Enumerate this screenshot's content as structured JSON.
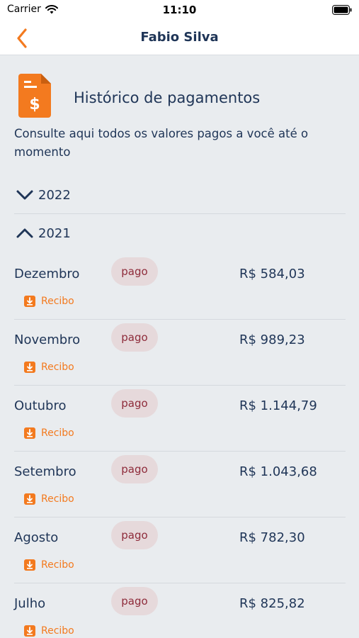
{
  "status_bar": {
    "carrier": "Carrier",
    "time": "11:10"
  },
  "nav": {
    "title": "Fabio Silva"
  },
  "header": {
    "title": "Histórico de pagamentos",
    "description": "Consulte aqui todos os valores pagos a você até o momento"
  },
  "years": [
    {
      "label": "2022",
      "expanded": false
    },
    {
      "label": "2021",
      "expanded": true
    }
  ],
  "payments": [
    {
      "month": "Dezembro",
      "status": "pago",
      "amount": "R$ 584,03",
      "receipt": "Recibo"
    },
    {
      "month": "Novembro",
      "status": "pago",
      "amount": "R$ 989,23",
      "receipt": "Recibo"
    },
    {
      "month": "Outubro",
      "status": "pago",
      "amount": "R$ 1.144,79",
      "receipt": "Recibo"
    },
    {
      "month": "Setembro",
      "status": "pago",
      "amount": "R$ 1.043,68",
      "receipt": "Recibo"
    },
    {
      "month": "Agosto",
      "status": "pago",
      "amount": "R$ 782,30",
      "receipt": "Recibo"
    },
    {
      "month": "Julho",
      "status": "pago",
      "amount": "R$ 825,82",
      "receipt": "Recibo"
    }
  ],
  "colors": {
    "accent": "#f37a1f",
    "text": "#1f3557",
    "background": "#e9ecef",
    "pill_bg": "#e6d9db",
    "pill_text": "#8e2b3a"
  },
  "icons": {
    "back": "chevron-left-icon",
    "document": "invoice-dollar-icon",
    "receipt": "download-icon",
    "collapsed": "chevron-down-icon",
    "expanded": "chevron-up-icon"
  }
}
